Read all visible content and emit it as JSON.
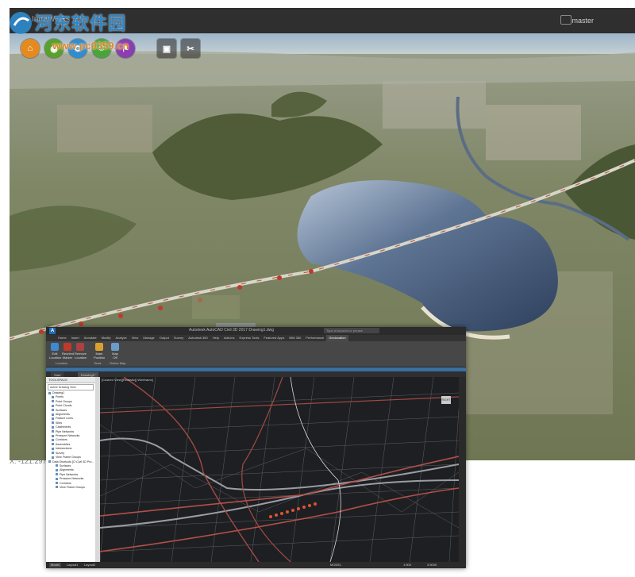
{
  "viewer": {
    "title": "InfraWorks",
    "user": "master",
    "coordinate": "X: -121.2975"
  },
  "watermark": {
    "text_cn": "河东软件园",
    "url": "www.pc0359.cn"
  },
  "toolbar_icons": [
    {
      "name": "home-icon",
      "glyph": "⌂",
      "color": "#e58a1f"
    },
    {
      "name": "globe-icon",
      "glyph": "◉",
      "color": "#5aa02c"
    },
    {
      "name": "gear-icon",
      "glyph": "⚙",
      "color": "#2f8dd0"
    },
    {
      "name": "smile-icon",
      "glyph": "☺",
      "color": "#49a53a"
    },
    {
      "name": "flag-icon",
      "glyph": "⚑",
      "color": "#8a3fb0"
    },
    {
      "name": "screen-icon",
      "glyph": "▣",
      "color": "#444"
    },
    {
      "name": "tools-icon",
      "glyph": "✂",
      "color": "#444"
    }
  ],
  "civil3d": {
    "app_letter": "A",
    "title": "Autodesk AutoCAD Civil 3D 2017  Drawing1.dwg",
    "search_placeholder": "Type a keyword or phrase",
    "tabs": [
      "Home",
      "Insert",
      "Annotate",
      "Modify",
      "Analyze",
      "View",
      "Manage",
      "Output",
      "Survey",
      "Autodesk 360",
      "Help",
      "Add-ins",
      "Express Tools",
      "Featured Apps",
      "BIM 360",
      "Performance",
      "Geolocation"
    ],
    "active_tab": "Geolocation",
    "ribbon_buttons": [
      "Edit Location",
      "Reorient Marker",
      "Remove Location",
      "Mark Position",
      "Map Off"
    ],
    "ribbon_groups": [
      "Location",
      "Tools",
      "Online Map"
    ],
    "doc_tabs": [
      "Start",
      "Drawing1*"
    ],
    "toolspace": {
      "header": "TOOLSPACE",
      "combo": "Active Drawing View",
      "items": [
        {
          "label": "Drawing1",
          "level": 0
        },
        {
          "label": "Points",
          "level": 1
        },
        {
          "label": "Point Groups",
          "level": 1
        },
        {
          "label": "Point Clouds",
          "level": 1
        },
        {
          "label": "Surfaces",
          "level": 1
        },
        {
          "label": "Alignments",
          "level": 1
        },
        {
          "label": "Feature Lines",
          "level": 1
        },
        {
          "label": "Sites",
          "level": 1
        },
        {
          "label": "Catchments",
          "level": 1
        },
        {
          "label": "Pipe Networks",
          "level": 1
        },
        {
          "label": "Pressure Networks",
          "level": 1
        },
        {
          "label": "Corridors",
          "level": 1
        },
        {
          "label": "Assemblies",
          "level": 1
        },
        {
          "label": "Intersections",
          "level": 1
        },
        {
          "label": "Survey",
          "level": 1
        },
        {
          "label": "View Frame Groups",
          "level": 1
        },
        {
          "label": "Data Shortcuts [C:\\Civil 3D Pro...",
          "level": 0
        },
        {
          "label": "Surfaces",
          "level": 2
        },
        {
          "label": "Alignments",
          "level": 2
        },
        {
          "label": "Pipe Networks",
          "level": 2
        },
        {
          "label": "Pressure Networks",
          "level": 2
        },
        {
          "label": "Corridors",
          "level": 2
        },
        {
          "label": "View Frame Groups",
          "level": 2
        }
      ]
    },
    "viewport_label": "[Custom View][Realistic][ Wireframe]",
    "navcube_label": "RIGHT",
    "status": {
      "model_tab": "Model",
      "layout1": "Layout1",
      "layout2": "Layout2",
      "model": "MODEL",
      "scale": "1:500",
      "scale2": "3.5000"
    }
  }
}
